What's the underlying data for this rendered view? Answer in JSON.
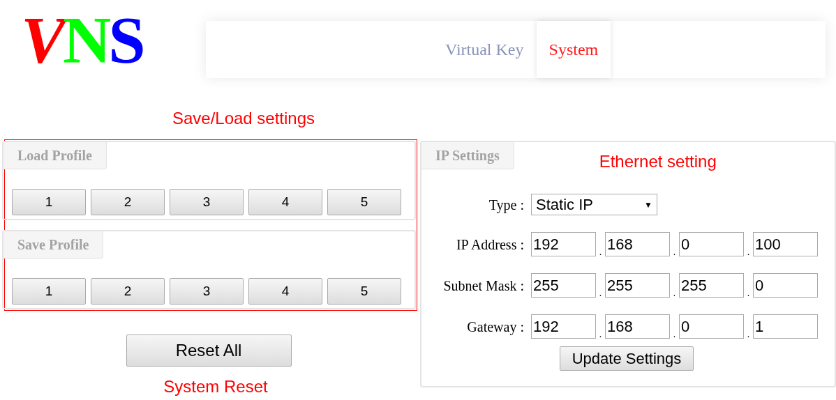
{
  "logo": {
    "letters": [
      {
        "text": "V",
        "color": "#ff0000"
      },
      {
        "text": "N",
        "color": "#00ff00"
      },
      {
        "text": "S",
        "color": "#0000ff"
      }
    ]
  },
  "nav": {
    "tabs": [
      {
        "label": "Virtual Key",
        "selected": false
      },
      {
        "label": "System",
        "selected": true
      }
    ]
  },
  "annotations": {
    "profiles": "Save/Load settings",
    "ethernet": "Ethernet setting",
    "reset": "System Reset"
  },
  "profiles": [
    {
      "title": "Load Profile",
      "buttons": [
        "1",
        "2",
        "3",
        "4",
        "5"
      ]
    },
    {
      "title": "Save Profile",
      "buttons": [
        "1",
        "2",
        "3",
        "4",
        "5"
      ]
    }
  ],
  "reset_button": "Reset All",
  "ip_settings": {
    "title": "IP Settings",
    "type": {
      "label": "Type :",
      "value": "Static IP",
      "caret": "▼"
    },
    "rows": [
      {
        "label": "IP Address :",
        "octets": [
          "192",
          "168",
          "0",
          "100"
        ]
      },
      {
        "label": "Subnet Mask :",
        "octets": [
          "255",
          "255",
          "255",
          "0"
        ]
      },
      {
        "label": "Gateway :",
        "octets": [
          "192",
          "168",
          "0",
          "1"
        ]
      }
    ],
    "separator": ".",
    "update_button": "Update Settings"
  }
}
